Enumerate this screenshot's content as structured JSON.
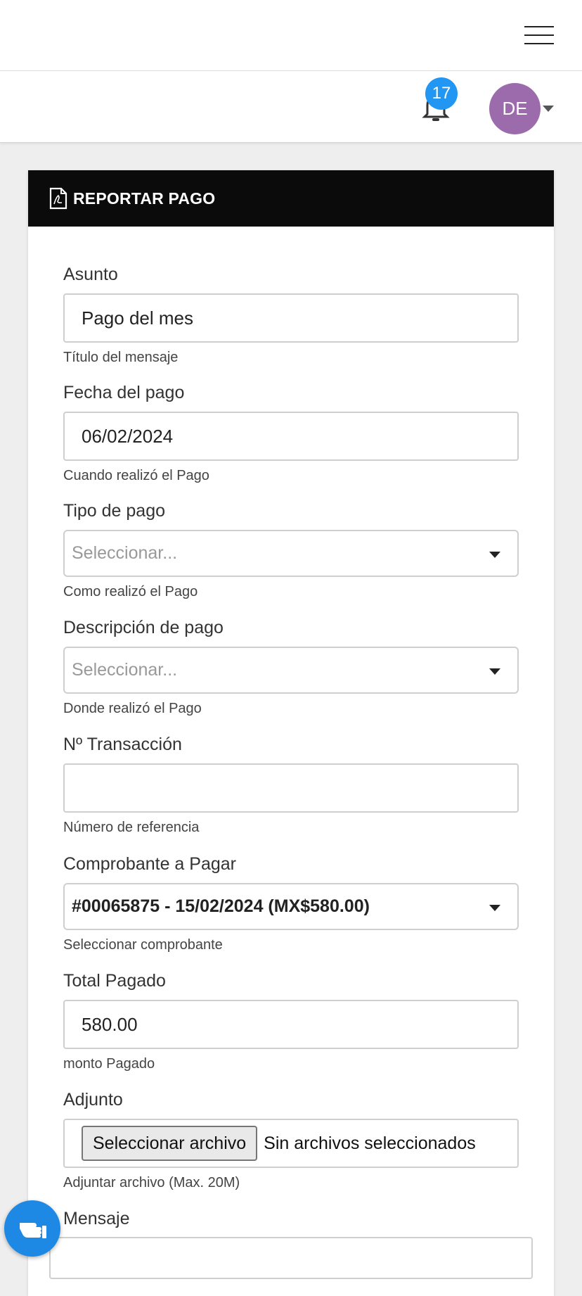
{
  "header": {
    "notifications_count": "17",
    "avatar_initials": "DE"
  },
  "card": {
    "title": "REPORTAR PAGO"
  },
  "fields": {
    "asunto": {
      "label": "Asunto",
      "value": "Pago del mes",
      "help": "Título del mensaje"
    },
    "fecha": {
      "label": "Fecha del pago",
      "value": "06/02/2024",
      "help": "Cuando realizó el Pago"
    },
    "tipo": {
      "label": "Tipo de pago",
      "placeholder": "Seleccionar...",
      "help": "Como realizó el Pago"
    },
    "descripcion": {
      "label": "Descripción de pago",
      "placeholder": "Seleccionar...",
      "help": "Donde realizó el Pago"
    },
    "transaccion": {
      "label": "Nº Transacción",
      "value": "",
      "help": "Número de referencia"
    },
    "comprobante": {
      "label": "Comprobante a Pagar",
      "value": "#00065875 - 15/02/2024 (MX$580.00)",
      "help": "Seleccionar comprobante"
    },
    "total": {
      "label": "Total Pagado",
      "value": "580.00",
      "help": "monto Pagado"
    },
    "adjunto": {
      "label": "Adjunto",
      "button": "Seleccionar archivo",
      "status": "Sin archivos seleccionados",
      "help": "Adjuntar archivo (Max. 20M)"
    },
    "mensaje": {
      "label": "Mensaje"
    }
  },
  "icons": {
    "menu": "hamburger-icon",
    "notifications": "bell-icon",
    "header": "file-pdf-icon",
    "fab": "pointing-hand-icon"
  },
  "colors": {
    "badge": "#2196f3",
    "avatar": "#9b6bab",
    "card_header": "#0b0b0b",
    "fab": "#1e88e5"
  }
}
